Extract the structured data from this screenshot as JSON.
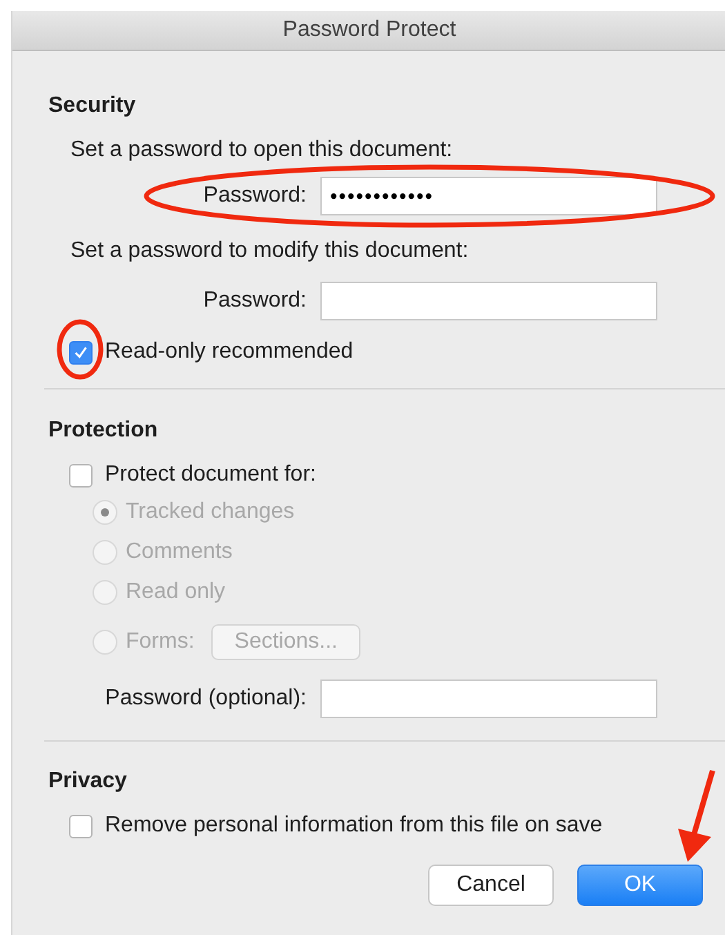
{
  "window": {
    "title": "Password Protect"
  },
  "security": {
    "heading": "Security",
    "open_label": "Set a password to open this document:",
    "open_password": {
      "label": "Password:",
      "value": "••••••••••••"
    },
    "modify_label": "Set a password to modify this document:",
    "modify_password": {
      "label": "Password:"
    },
    "read_only": {
      "label": "Read-only recommended",
      "checked": true
    }
  },
  "protection": {
    "heading": "Protection",
    "protect": {
      "label": "Protect document for:",
      "checked": false
    },
    "options": [
      {
        "label": "Tracked changes",
        "selected": true,
        "disabled": true
      },
      {
        "label": "Comments",
        "selected": false,
        "disabled": true
      },
      {
        "label": "Read only",
        "selected": false,
        "disabled": true
      },
      {
        "label": "Forms:",
        "selected": false,
        "disabled": true,
        "button": "Sections..."
      }
    ],
    "password_optional": {
      "label": "Password (optional):"
    }
  },
  "privacy": {
    "heading": "Privacy",
    "remove_info": {
      "label": "Remove personal information from this file on save",
      "checked": false
    }
  },
  "buttons": [
    {
      "label": "Cancel",
      "kind": "default"
    },
    {
      "label": "OK",
      "kind": "primary"
    }
  ],
  "annotations": [
    {
      "kind": "ellipse"
    },
    {
      "kind": "circle"
    },
    {
      "kind": "arrow"
    }
  ]
}
